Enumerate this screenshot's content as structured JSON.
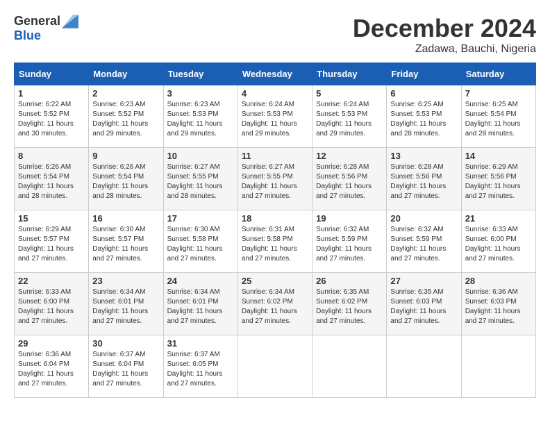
{
  "logo": {
    "general": "General",
    "blue": "Blue"
  },
  "title": "December 2024",
  "location": "Zadawa, Bauchi, Nigeria",
  "days_of_week": [
    "Sunday",
    "Monday",
    "Tuesday",
    "Wednesday",
    "Thursday",
    "Friday",
    "Saturday"
  ],
  "weeks": [
    [
      {
        "day": "1",
        "info": "Sunrise: 6:22 AM\nSunset: 5:52 PM\nDaylight: 11 hours\nand 30 minutes."
      },
      {
        "day": "2",
        "info": "Sunrise: 6:23 AM\nSunset: 5:52 PM\nDaylight: 11 hours\nand 29 minutes."
      },
      {
        "day": "3",
        "info": "Sunrise: 6:23 AM\nSunset: 5:53 PM\nDaylight: 11 hours\nand 29 minutes."
      },
      {
        "day": "4",
        "info": "Sunrise: 6:24 AM\nSunset: 5:53 PM\nDaylight: 11 hours\nand 29 minutes."
      },
      {
        "day": "5",
        "info": "Sunrise: 6:24 AM\nSunset: 5:53 PM\nDaylight: 11 hours\nand 29 minutes."
      },
      {
        "day": "6",
        "info": "Sunrise: 6:25 AM\nSunset: 5:53 PM\nDaylight: 11 hours\nand 28 minutes."
      },
      {
        "day": "7",
        "info": "Sunrise: 6:25 AM\nSunset: 5:54 PM\nDaylight: 11 hours\nand 28 minutes."
      }
    ],
    [
      {
        "day": "8",
        "info": "Sunrise: 6:26 AM\nSunset: 5:54 PM\nDaylight: 11 hours\nand 28 minutes."
      },
      {
        "day": "9",
        "info": "Sunrise: 6:26 AM\nSunset: 5:54 PM\nDaylight: 11 hours\nand 28 minutes."
      },
      {
        "day": "10",
        "info": "Sunrise: 6:27 AM\nSunset: 5:55 PM\nDaylight: 11 hours\nand 28 minutes."
      },
      {
        "day": "11",
        "info": "Sunrise: 6:27 AM\nSunset: 5:55 PM\nDaylight: 11 hours\nand 27 minutes."
      },
      {
        "day": "12",
        "info": "Sunrise: 6:28 AM\nSunset: 5:56 PM\nDaylight: 11 hours\nand 27 minutes."
      },
      {
        "day": "13",
        "info": "Sunrise: 6:28 AM\nSunset: 5:56 PM\nDaylight: 11 hours\nand 27 minutes."
      },
      {
        "day": "14",
        "info": "Sunrise: 6:29 AM\nSunset: 5:56 PM\nDaylight: 11 hours\nand 27 minutes."
      }
    ],
    [
      {
        "day": "15",
        "info": "Sunrise: 6:29 AM\nSunset: 5:57 PM\nDaylight: 11 hours\nand 27 minutes."
      },
      {
        "day": "16",
        "info": "Sunrise: 6:30 AM\nSunset: 5:57 PM\nDaylight: 11 hours\nand 27 minutes."
      },
      {
        "day": "17",
        "info": "Sunrise: 6:30 AM\nSunset: 5:58 PM\nDaylight: 11 hours\nand 27 minutes."
      },
      {
        "day": "18",
        "info": "Sunrise: 6:31 AM\nSunset: 5:58 PM\nDaylight: 11 hours\nand 27 minutes."
      },
      {
        "day": "19",
        "info": "Sunrise: 6:32 AM\nSunset: 5:59 PM\nDaylight: 11 hours\nand 27 minutes."
      },
      {
        "day": "20",
        "info": "Sunrise: 6:32 AM\nSunset: 5:59 PM\nDaylight: 11 hours\nand 27 minutes."
      },
      {
        "day": "21",
        "info": "Sunrise: 6:33 AM\nSunset: 6:00 PM\nDaylight: 11 hours\nand 27 minutes."
      }
    ],
    [
      {
        "day": "22",
        "info": "Sunrise: 6:33 AM\nSunset: 6:00 PM\nDaylight: 11 hours\nand 27 minutes."
      },
      {
        "day": "23",
        "info": "Sunrise: 6:34 AM\nSunset: 6:01 PM\nDaylight: 11 hours\nand 27 minutes."
      },
      {
        "day": "24",
        "info": "Sunrise: 6:34 AM\nSunset: 6:01 PM\nDaylight: 11 hours\nand 27 minutes."
      },
      {
        "day": "25",
        "info": "Sunrise: 6:34 AM\nSunset: 6:02 PM\nDaylight: 11 hours\nand 27 minutes."
      },
      {
        "day": "26",
        "info": "Sunrise: 6:35 AM\nSunset: 6:02 PM\nDaylight: 11 hours\nand 27 minutes."
      },
      {
        "day": "27",
        "info": "Sunrise: 6:35 AM\nSunset: 6:03 PM\nDaylight: 11 hours\nand 27 minutes."
      },
      {
        "day": "28",
        "info": "Sunrise: 6:36 AM\nSunset: 6:03 PM\nDaylight: 11 hours\nand 27 minutes."
      }
    ],
    [
      {
        "day": "29",
        "info": "Sunrise: 6:36 AM\nSunset: 6:04 PM\nDaylight: 11 hours\nand 27 minutes."
      },
      {
        "day": "30",
        "info": "Sunrise: 6:37 AM\nSunset: 6:04 PM\nDaylight: 11 hours\nand 27 minutes."
      },
      {
        "day": "31",
        "info": "Sunrise: 6:37 AM\nSunset: 6:05 PM\nDaylight: 11 hours\nand 27 minutes."
      },
      {
        "day": "",
        "info": ""
      },
      {
        "day": "",
        "info": ""
      },
      {
        "day": "",
        "info": ""
      },
      {
        "day": "",
        "info": ""
      }
    ]
  ]
}
